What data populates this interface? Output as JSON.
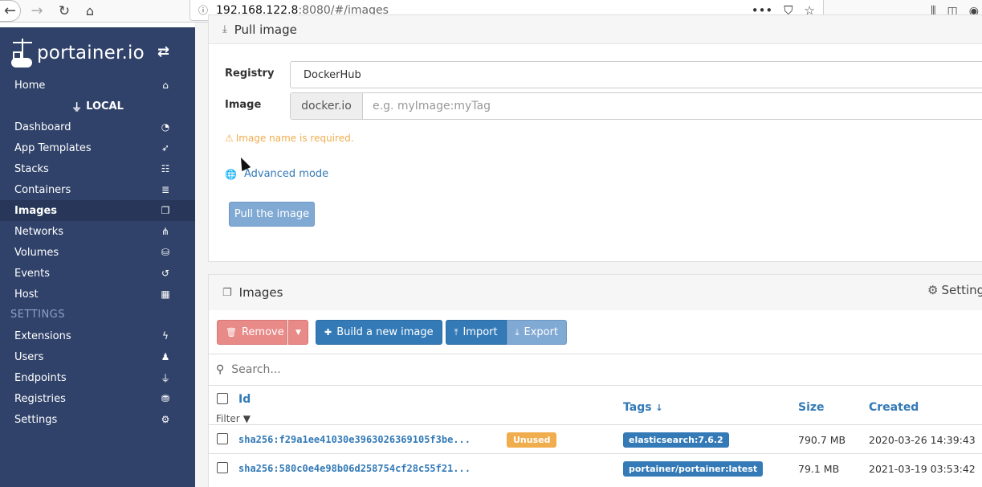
{
  "browser": {
    "url_host": "192.168.122.8",
    "url_path": ":8080/#/images",
    "more_glyph": "•••"
  },
  "sidebar": {
    "logo_text": "portainer.io",
    "home": "Home",
    "endpoint": "LOCAL",
    "items": [
      {
        "label": "Dashboard"
      },
      {
        "label": "App Templates"
      },
      {
        "label": "Stacks"
      },
      {
        "label": "Containers"
      },
      {
        "label": "Images"
      },
      {
        "label": "Networks"
      },
      {
        "label": "Volumes"
      },
      {
        "label": "Events"
      },
      {
        "label": "Host"
      }
    ],
    "settings_header": "SETTINGS",
    "settings_items": [
      {
        "label": "Extensions"
      },
      {
        "label": "Users"
      },
      {
        "label": "Endpoints"
      },
      {
        "label": "Registries"
      },
      {
        "label": "Settings"
      }
    ]
  },
  "pull": {
    "title": "Pull image",
    "registry_label": "Registry",
    "registry_value": "DockerHub",
    "image_label": "Image",
    "image_prefix": "docker.io",
    "image_placeholder": "e.g. myImage:myTag",
    "warning": "Image name is required.",
    "advanced": "Advanced mode",
    "pull_button": "Pull the image"
  },
  "images": {
    "title": "Images",
    "settings": "Settings",
    "remove": "Remove",
    "build": "Build a new image",
    "import": "Import",
    "export": "Export",
    "search_placeholder": "Search...",
    "columns": {
      "id": "Id",
      "filter": "Filter",
      "tags": "Tags",
      "size": "Size",
      "created": "Created"
    },
    "rows": [
      {
        "id": "sha256:f29a1ee41030e3963026369105f3be...",
        "unused": "Unused",
        "tag": "elasticsearch:7.6.2",
        "size": "790.7 MB",
        "created": "2020-03-26 14:39:43"
      },
      {
        "id": "sha256:580c0e4e98b06d258754cf28c55f21...",
        "unused": "",
        "tag": "portainer/portainer:latest",
        "size": "79.1 MB",
        "created": "2021-03-19 03:53:42"
      }
    ]
  },
  "colors": {
    "sidebar_bg": "#30426a",
    "primary": "#337ab7",
    "warning": "#f0ad4e",
    "danger": "#e88a88"
  }
}
